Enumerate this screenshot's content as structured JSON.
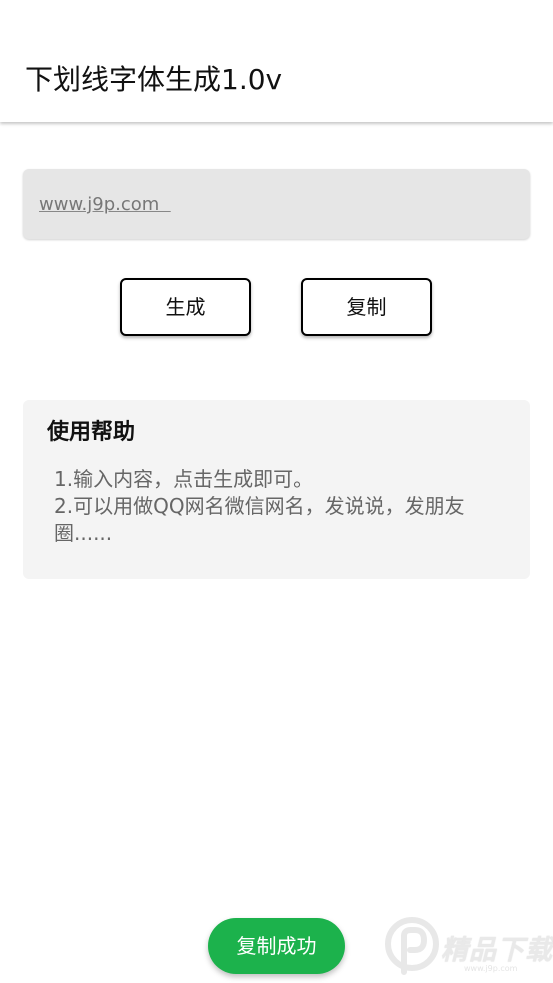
{
  "appbar": {
    "title": "下划线字体生成1.0v"
  },
  "input": {
    "value": "www.j9p.com  "
  },
  "actions": {
    "generate_label": "生成",
    "copy_label": "复制"
  },
  "help": {
    "title": "使用帮助",
    "lines": [
      "1.输入内容，点击生成即可。",
      "2.可以用做QQ网名微信网名，发说说，发朋友圈......"
    ]
  },
  "toast": {
    "message": "复制成功",
    "color": "#1cb24c"
  },
  "watermark": {
    "brand": "精品下载",
    "url": "www.j9p.com",
    "logo_icon": "p-logo-icon"
  }
}
